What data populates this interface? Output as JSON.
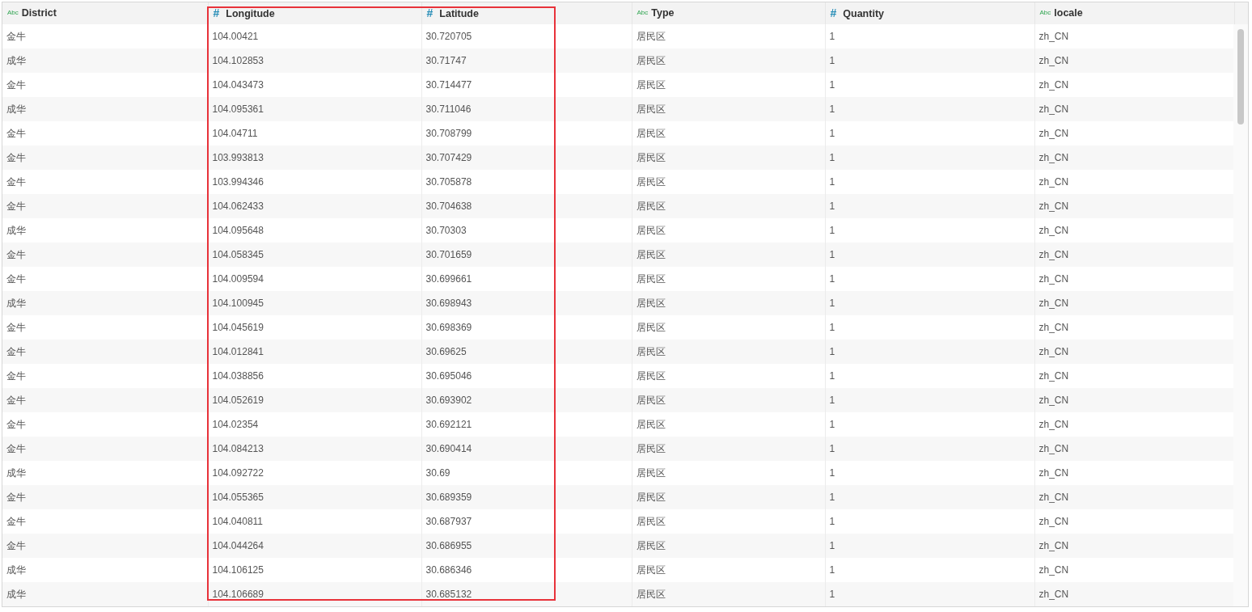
{
  "columns": [
    {
      "label": "District",
      "kind": "text",
      "type_icon": "Abc",
      "highlighted": false
    },
    {
      "label": "Longitude",
      "kind": "number",
      "type_icon": "#",
      "highlighted": true
    },
    {
      "label": "Latitude",
      "kind": "number",
      "type_icon": "#",
      "highlighted": true
    },
    {
      "label": "Type",
      "kind": "text",
      "type_icon": "Abc",
      "highlighted": false
    },
    {
      "label": "Quantity",
      "kind": "number",
      "type_icon": "#",
      "highlighted": false
    },
    {
      "label": "locale",
      "kind": "text",
      "type_icon": "Abc",
      "highlighted": false
    }
  ],
  "rows": [
    [
      "金牛",
      "104.00421",
      "30.720705",
      "居民区",
      "1",
      "zh_CN"
    ],
    [
      "成华",
      "104.102853",
      "30.71747",
      "居民区",
      "1",
      "zh_CN"
    ],
    [
      "金牛",
      "104.043473",
      "30.714477",
      "居民区",
      "1",
      "zh_CN"
    ],
    [
      "成华",
      "104.095361",
      "30.711046",
      "居民区",
      "1",
      "zh_CN"
    ],
    [
      "金牛",
      "104.04711",
      "30.708799",
      "居民区",
      "1",
      "zh_CN"
    ],
    [
      "金牛",
      "103.993813",
      "30.707429",
      "居民区",
      "1",
      "zh_CN"
    ],
    [
      "金牛",
      "103.994346",
      "30.705878",
      "居民区",
      "1",
      "zh_CN"
    ],
    [
      "金牛",
      "104.062433",
      "30.704638",
      "居民区",
      "1",
      "zh_CN"
    ],
    [
      "成华",
      "104.095648",
      "30.70303",
      "居民区",
      "1",
      "zh_CN"
    ],
    [
      "金牛",
      "104.058345",
      "30.701659",
      "居民区",
      "1",
      "zh_CN"
    ],
    [
      "金牛",
      "104.009594",
      "30.699661",
      "居民区",
      "1",
      "zh_CN"
    ],
    [
      "成华",
      "104.100945",
      "30.698943",
      "居民区",
      "1",
      "zh_CN"
    ],
    [
      "金牛",
      "104.045619",
      "30.698369",
      "居民区",
      "1",
      "zh_CN"
    ],
    [
      "金牛",
      "104.012841",
      "30.69625",
      "居民区",
      "1",
      "zh_CN"
    ],
    [
      "金牛",
      "104.038856",
      "30.695046",
      "居民区",
      "1",
      "zh_CN"
    ],
    [
      "金牛",
      "104.052619",
      "30.693902",
      "居民区",
      "1",
      "zh_CN"
    ],
    [
      "金牛",
      "104.02354",
      "30.692121",
      "居民区",
      "1",
      "zh_CN"
    ],
    [
      "金牛",
      "104.084213",
      "30.690414",
      "居民区",
      "1",
      "zh_CN"
    ],
    [
      "成华",
      "104.092722",
      "30.69",
      "居民区",
      "1",
      "zh_CN"
    ],
    [
      "金牛",
      "104.055365",
      "30.689359",
      "居民区",
      "1",
      "zh_CN"
    ],
    [
      "金牛",
      "104.040811",
      "30.687937",
      "居民区",
      "1",
      "zh_CN"
    ],
    [
      "金牛",
      "104.044264",
      "30.686955",
      "居民区",
      "1",
      "zh_CN"
    ],
    [
      "成华",
      "104.106125",
      "30.686346",
      "居民区",
      "1",
      "zh_CN"
    ],
    [
      "成华",
      "104.106689",
      "30.685132",
      "居民区",
      "1",
      "zh_CN"
    ]
  ]
}
